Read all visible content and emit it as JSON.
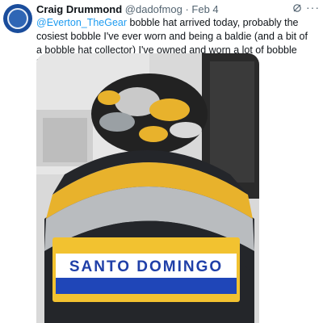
{
  "tweet": {
    "author_name": "Craig Drummond",
    "handle": "@dadofmog",
    "separator": "·",
    "time": "Feb 4",
    "mention": "@Everton_TheGear",
    "body": " bobble hat arrived today, probably the cosiest bobble I've ever worn and being a baldie (and a bit of a bobble hat collector) I've owned and worn a lot of bobble hats!!!",
    "more_label": "···",
    "grok_icon": "grok-icon",
    "avatar_icon": "avatar-logo"
  },
  "photo": {
    "badge_text": "SANTO DOMINGO",
    "colors": {
      "hat_dark": "#24262a",
      "stripe_yellow": "#e8b22c",
      "stripe_grey": "#b9bcbf",
      "badge_yellow": "#f2c230",
      "badge_blue": "#1f46b8",
      "badge_text": "#1f3fa8"
    }
  }
}
